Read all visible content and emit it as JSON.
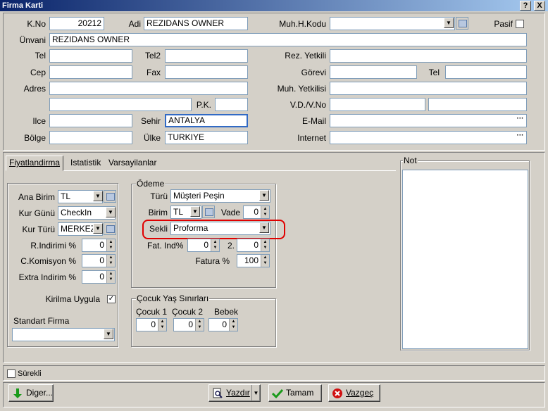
{
  "title": "Firma Karti",
  "titlebar_buttons": {
    "help": "?",
    "close": "X"
  },
  "header": {
    "kno_label": "K.No",
    "kno_value": "20212",
    "adi_label": "Adi",
    "adi_value": "REZIDANS OWNER",
    "muh_kodu_label": "Muh.H.Kodu",
    "muh_kodu_value": "",
    "pasif_label": "Pasif",
    "unvani_label": "Ünvani",
    "unvani_value": "REZIDANS OWNER",
    "tel_label": "Tel",
    "tel2_label": "Tel2",
    "rez_yetkili_label": "Rez. Yetkili",
    "cep_label": "Cep",
    "fax_label": "Fax",
    "gorevi_label": "Görevi",
    "tel_b_label": "Tel",
    "adres_label": "Adres",
    "muh_yetkilisi_label": "Muh. Yetkilisi",
    "pk_label": "P.K.",
    "vd_label": "V.D./V.No",
    "ilce_label": "Ilce",
    "sehir_label": "Sehir",
    "sehir_value": "ANTALYA",
    "email_label": "E-Mail",
    "bolge_label": "Bölge",
    "ulke_label": "Ülke",
    "ulke_value": "TURKIYE",
    "internet_label": "Internet"
  },
  "tabs": [
    "Fiyatlandirma",
    "Istatistik",
    "Varsayilanlar"
  ],
  "pricing": {
    "ana_birim_label": "Ana Birim",
    "ana_birim_value": "TL",
    "kur_gunu_label": "Kur Günü",
    "kur_gunu_value": "CheckIn",
    "kur_turu_label": "Kur Türü",
    "kur_turu_value": "MERKEZ",
    "rindirimi_label": "R.Indirimi %",
    "rindirimi_value": "0",
    "ckomisyon_label": "C.Komisyon %",
    "ckomisyon_value": "0",
    "extra_label": "Extra Indirim %",
    "extra_value": "0",
    "kirilma_label": "Kirilma Uygula",
    "standart_firma_label": "Standart Firma",
    "standart_firma_value": ""
  },
  "odeme": {
    "title": "Ödeme",
    "turu_label": "Türü",
    "turu_value": "Müşteri Peşin",
    "birim_label": "Birim",
    "birim_value": "TL",
    "vade_label": "Vade",
    "vade_value": "0",
    "sekli_label": "Sekli",
    "sekli_value": "Proforma",
    "fat_ind_label": "Fat. Ind%",
    "fat_ind_value": "0",
    "fat_ind2_label": "2.",
    "fat_ind2_value": "0",
    "fatura_label": "Fatura %",
    "fatura_value": "100"
  },
  "cocuk": {
    "title": "Çocuk Yaş Sınırları",
    "c1_label": "Çocuk 1",
    "c1_value": "0",
    "c2_label": "Çocuk 2",
    "c2_value": "0",
    "bebek_label": "Bebek",
    "bebek_value": "0"
  },
  "not_label": "Not",
  "surekli_label": "Sürekli",
  "buttons": {
    "diger": "Diger...",
    "yazdir": "Yazdır",
    "tamam": "Tamam",
    "vazgec": "Vazgeç"
  },
  "colors": {
    "highlight": "#e00000",
    "title_start": "#0a246a"
  }
}
